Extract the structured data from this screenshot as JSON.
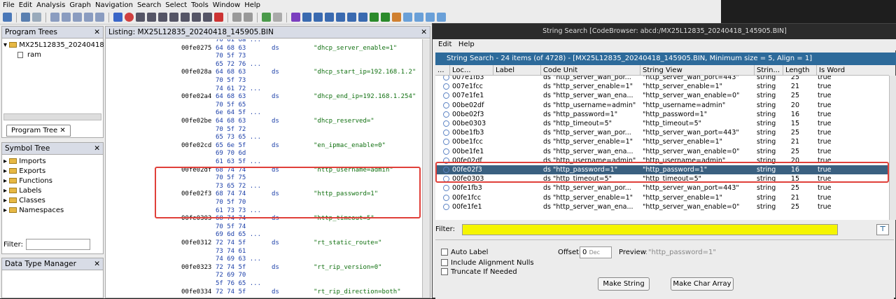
{
  "menubar": [
    "File",
    "Edit",
    "Analysis",
    "Graph",
    "Navigation",
    "Search",
    "Select",
    "Tools",
    "Window",
    "Help"
  ],
  "program_trees": {
    "title": "Program Trees",
    "root": "MX25L12835_20240418",
    "child": "ram",
    "tab": "Program Tree"
  },
  "symbol_tree": {
    "title": "Symbol Tree",
    "items": [
      "Imports",
      "Exports",
      "Functions",
      "Labels",
      "Classes",
      "Namespaces"
    ],
    "filter_label": "Filter:"
  },
  "data_type_manager": {
    "title": "Data Type Manager"
  },
  "listing": {
    "title": "Listing:  MX25L12835_20240418_145905.BIN",
    "rows": [
      {
        "addr": "",
        "bytes": "70 61 6a ...",
        "op": "",
        "str": ""
      },
      {
        "addr": "00fe0275",
        "bytes": "64 68 63",
        "op": "ds",
        "str": "\"dhcp_server_enable=1\""
      },
      {
        "addr": "",
        "bytes": "70 5f 73",
        "op": "",
        "str": ""
      },
      {
        "addr": "",
        "bytes": "65 72 76 ...",
        "op": "",
        "str": ""
      },
      {
        "addr": "00fe028a",
        "bytes": "64 68 63",
        "op": "ds",
        "str": "\"dhcp_start_ip=192.168.1.2\""
      },
      {
        "addr": "",
        "bytes": "70 5f 73",
        "op": "",
        "str": ""
      },
      {
        "addr": "",
        "bytes": "74 61 72 ...",
        "op": "",
        "str": ""
      },
      {
        "addr": "00fe02a4",
        "bytes": "64 68 63",
        "op": "ds",
        "str": "\"dhcp_end_ip=192.168.1.254\""
      },
      {
        "addr": "",
        "bytes": "70 5f 65",
        "op": "",
        "str": ""
      },
      {
        "addr": "",
        "bytes": "6e 64 5f ...",
        "op": "",
        "str": ""
      },
      {
        "addr": "00fe02be",
        "bytes": "64 68 63",
        "op": "ds",
        "str": "\"dhcp_reserved=\""
      },
      {
        "addr": "",
        "bytes": "70 5f 72",
        "op": "",
        "str": ""
      },
      {
        "addr": "",
        "bytes": "65 73 65 ...",
        "op": "",
        "str": ""
      },
      {
        "addr": "00fe02cd",
        "bytes": "65 6e 5f",
        "op": "ds",
        "str": "\"en_ipmac_enable=0\""
      },
      {
        "addr": "",
        "bytes": "69 70 6d",
        "op": "",
        "str": ""
      },
      {
        "addr": "",
        "bytes": "61 63 5f ...",
        "op": "",
        "str": ""
      },
      {
        "addr": "00fe02df",
        "bytes": "68 74 74",
        "op": "ds",
        "str": "\"http_username=admin\""
      },
      {
        "addr": "",
        "bytes": "70 5f 75",
        "op": "",
        "str": ""
      },
      {
        "addr": "",
        "bytes": "73 65 72 ...",
        "op": "",
        "str": ""
      },
      {
        "addr": "00fe02f3",
        "bytes": "68 74 74",
        "op": "ds",
        "str": "\"http_password=1\""
      },
      {
        "addr": "",
        "bytes": "70 5f 70",
        "op": "",
        "str": ""
      },
      {
        "addr": "",
        "bytes": "61 73 73 ...",
        "op": "",
        "str": ""
      },
      {
        "addr": "00fe0303",
        "bytes": "68 74 74",
        "op": "ds",
        "str": "\"http_timeout=5\""
      },
      {
        "addr": "",
        "bytes": "70 5f 74",
        "op": "",
        "str": ""
      },
      {
        "addr": "",
        "bytes": "69 6d 65 ...",
        "op": "",
        "str": ""
      },
      {
        "addr": "00fe0312",
        "bytes": "72 74 5f",
        "op": "ds",
        "str": "\"rt_static_route=\""
      },
      {
        "addr": "",
        "bytes": "73 74 61",
        "op": "",
        "str": ""
      },
      {
        "addr": "",
        "bytes": "74 69 63 ...",
        "op": "",
        "str": ""
      },
      {
        "addr": "00fe0323",
        "bytes": "72 74 5f",
        "op": "ds",
        "str": "\"rt_rip_version=0\""
      },
      {
        "addr": "",
        "bytes": "72 69 70",
        "op": "",
        "str": ""
      },
      {
        "addr": "",
        "bytes": "5f 76 65 ...",
        "op": "",
        "str": ""
      },
      {
        "addr": "00fe0334",
        "bytes": "72 74 5f",
        "op": "ds",
        "str": "\"rt_rip_direction=both\""
      }
    ]
  },
  "string_search": {
    "window_title": "String Search [CodeBrowser: abcd:/MX25L12835_20240418_145905.BIN]",
    "menu": [
      "Edit",
      "Help"
    ],
    "subtitle": "String Search - 24 items (of 4728) - [MX25L12835_20240418_145905.BIN, Minimum size = 5, Align = 1]",
    "columns": [
      "...",
      "Loc...",
      "Label",
      "Code Unit",
      "String View",
      "Strin...",
      "Length",
      "Is Word"
    ],
    "rows": [
      {
        "loc": "007e1fb3",
        "cu": "ds \"http_server_wan_por...",
        "sv": "\"http_server_wan_port=443\"",
        "type": "string",
        "len": "25",
        "word": "true"
      },
      {
        "loc": "007e1fcc",
        "cu": "ds \"http_server_enable=1\"",
        "sv": "\"http_server_enable=1\"",
        "type": "string",
        "len": "21",
        "word": "true"
      },
      {
        "loc": "007e1fe1",
        "cu": "ds \"http_server_wan_ena...",
        "sv": "\"http_server_wan_enable=0\"",
        "type": "string",
        "len": "25",
        "word": "true"
      },
      {
        "loc": "00be02df",
        "cu": "ds \"http_username=admin\"",
        "sv": "\"http_username=admin\"",
        "type": "string",
        "len": "20",
        "word": "true"
      },
      {
        "loc": "00be02f3",
        "cu": "ds \"http_password=1\"",
        "sv": "\"http_password=1\"",
        "type": "string",
        "len": "16",
        "word": "true"
      },
      {
        "loc": "00be0303",
        "cu": "ds \"http_timeout=5\"",
        "sv": "\"http_timeout=5\"",
        "type": "string",
        "len": "15",
        "word": "true"
      },
      {
        "loc": "00be1fb3",
        "cu": "ds \"http_server_wan_por...",
        "sv": "\"http_server_wan_port=443\"",
        "type": "string",
        "len": "25",
        "word": "true"
      },
      {
        "loc": "00be1fcc",
        "cu": "ds \"http_server_enable=1\"",
        "sv": "\"http_server_enable=1\"",
        "type": "string",
        "len": "21",
        "word": "true"
      },
      {
        "loc": "00be1fe1",
        "cu": "ds \"http_server_wan_ena...",
        "sv": "\"http_server_wan_enable=0\"",
        "type": "string",
        "len": "25",
        "word": "true"
      },
      {
        "loc": "00fe02df",
        "cu": "ds \"http_username=admin\"",
        "sv": "\"http_username=admin\"",
        "type": "string",
        "len": "20",
        "word": "true"
      },
      {
        "loc": "00fe02f3",
        "cu": "ds \"http_password=1\"",
        "sv": "\"http_password=1\"",
        "type": "string",
        "len": "16",
        "word": "true"
      },
      {
        "loc": "00fe0303",
        "cu": "ds \"http_timeout=5\"",
        "sv": "\"http_timeout=5\"",
        "type": "string",
        "len": "15",
        "word": "true"
      },
      {
        "loc": "00fe1fb3",
        "cu": "ds \"http_server_wan_por...",
        "sv": "\"http_server_wan_port=443\"",
        "type": "string",
        "len": "25",
        "word": "true"
      },
      {
        "loc": "00fe1fcc",
        "cu": "ds \"http_server_enable=1\"",
        "sv": "\"http_server_enable=1\"",
        "type": "string",
        "len": "21",
        "word": "true"
      },
      {
        "loc": "00fe1fe1",
        "cu": "ds \"http_server_wan_ena...",
        "sv": "\"http_server_wan_enable=0\"",
        "type": "string",
        "len": "25",
        "word": "true"
      }
    ],
    "selected_row": 10,
    "filter_label": "Filter:",
    "auto_label": "Auto Label",
    "include_nulls": "Include Alignment Nulls",
    "truncate": "Truncate If Needed",
    "offset_label": "Offset:",
    "offset_value": "0",
    "offset_unit": "Dec",
    "preview_label": "Preview:",
    "preview_value": "\"http_password=1\"",
    "make_string": "Make String",
    "make_char_array": "Make Char Array"
  },
  "colors": {
    "highlight": "#e0403a",
    "filter_bg": "#f5f500",
    "selected_row": "#3a6080",
    "subtitle_bg": "#2d6a9a"
  }
}
